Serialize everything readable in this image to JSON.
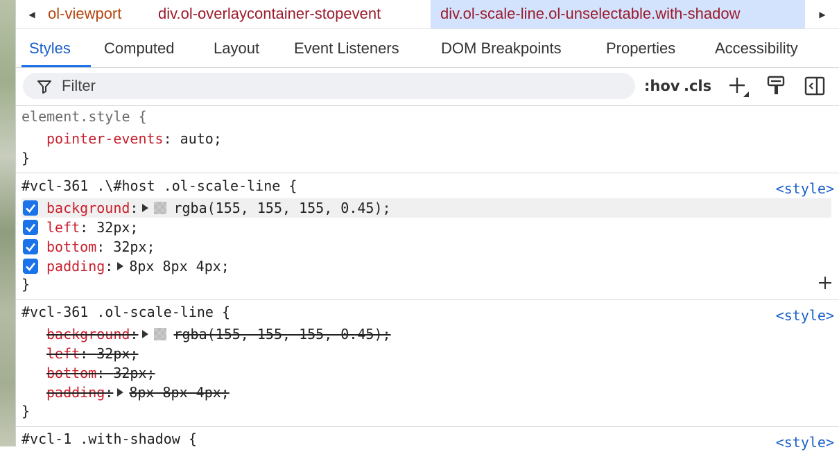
{
  "breadcrumbs": {
    "items": [
      {
        "label": "ol-viewport",
        "color": "#b5460f",
        "selected": false
      },
      {
        "label": "div.ol-overlaycontainer-stopevent",
        "color": "#9b1b2c",
        "selected": false
      },
      {
        "label": "div.ol-scale-line.ol-unselectable.with-shadow",
        "color": "#9b1b2c",
        "selected": true
      }
    ]
  },
  "tabs": [
    "Styles",
    "Computed",
    "Layout",
    "Event Listeners",
    "DOM Breakpoints",
    "Properties",
    "Accessibility"
  ],
  "active_tab": "Styles",
  "toolbar": {
    "filter_placeholder": "Filter",
    "hov_label": ":hov",
    "cls_label": ".cls"
  },
  "colors": {
    "accent": "#1a73e8",
    "property": "#c8202e",
    "link": "#1a5fc8",
    "swatch": "rgba(155, 155, 155, 0.45)"
  },
  "rules": [
    {
      "selector": "element.style {",
      "close": "}",
      "declarations": [
        {
          "name": "pointer-events",
          "sep": ": ",
          "value": "auto;"
        }
      ]
    },
    {
      "selector": "#vcl-361 .\\#host .ol-scale-line {",
      "source": "<style>",
      "close": "}",
      "declarations": [
        {
          "name": "background",
          "sep": ":",
          "value": "rgba(155, 155, 155, 0.45);",
          "checked": true
        },
        {
          "name": "left",
          "sep": ": ",
          "value": "32px;",
          "checked": true
        },
        {
          "name": "bottom",
          "sep": ": ",
          "value": "32px;",
          "checked": true
        },
        {
          "name": "padding",
          "sep": ":",
          "value": "8px 8px 4px;",
          "checked": true
        }
      ]
    },
    {
      "selector": "#vcl-361 .ol-scale-line {",
      "source": "<style>",
      "close": "}",
      "declarations": [
        {
          "name": "background",
          "sep": ":",
          "value": "rgba(155, 155, 155, 0.45);"
        },
        {
          "name": "left",
          "sep": ": ",
          "value": "32px;"
        },
        {
          "name": "bottom",
          "sep": ": ",
          "value": "32px;"
        },
        {
          "name": "padding",
          "sep": ":",
          "value": "8px 8px 4px;"
        }
      ]
    },
    {
      "selector": "#vcl-1 .with-shadow {",
      "source": "<style>"
    }
  ]
}
